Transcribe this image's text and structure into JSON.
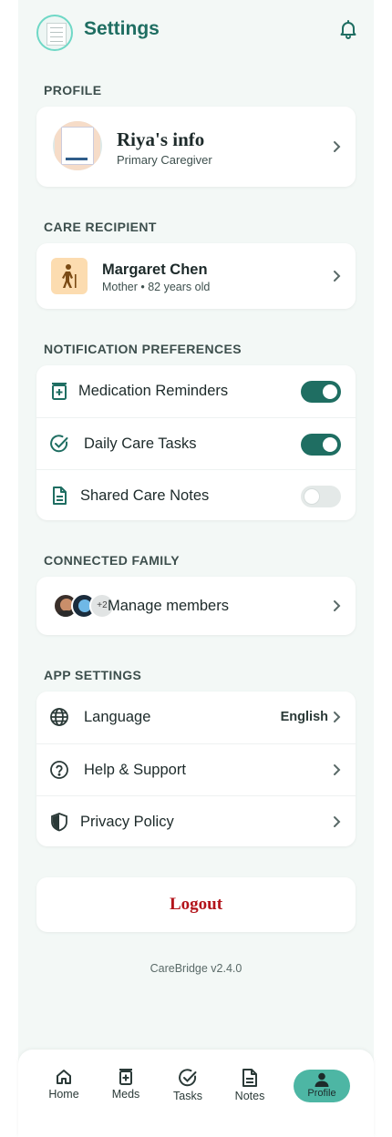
{
  "header": {
    "title": "Settings",
    "logo_icon": "document-icon",
    "bell_icon": "bell-icon"
  },
  "profile": {
    "section_label": "PROFILE",
    "name": "Riya's info",
    "role": "Primary Caregiver"
  },
  "care_recipient": {
    "section_label": "CARE RECIPIENT",
    "name": "Margaret Chen",
    "detail": "Mother • 82 years old",
    "avatar_icon": "elderly-person-icon",
    "avatar_bg": "#fcdcb0"
  },
  "notifications": {
    "section_label": "NOTIFICATION PREFERENCES",
    "items": [
      {
        "label": "Medication Reminders",
        "icon": "medication-icon",
        "enabled": true
      },
      {
        "label": "Daily Care Tasks",
        "icon": "check-circle-icon",
        "enabled": true
      },
      {
        "label": "Shared Care Notes",
        "icon": "notes-document-icon",
        "enabled": false
      }
    ]
  },
  "family": {
    "section_label": "CONNECTED FAMILY",
    "extra_count": "+2",
    "action": "Manage members"
  },
  "app_settings": {
    "section_label": "APP SETTINGS",
    "items": [
      {
        "label": "Language",
        "icon": "globe-icon",
        "value": "English"
      },
      {
        "label": "Help & Support",
        "icon": "help-circle-icon",
        "value": ""
      },
      {
        "label": "Privacy Policy",
        "icon": "shield-icon",
        "value": ""
      }
    ]
  },
  "logout": {
    "label": "Logout"
  },
  "footer": {
    "version": "CareBridge v2.4.0"
  },
  "nav": {
    "items": [
      {
        "label": "Home",
        "icon": "home-icon"
      },
      {
        "label": "Meds",
        "icon": "medication-icon"
      },
      {
        "label": "Tasks",
        "icon": "check-circle-icon"
      },
      {
        "label": "Notes",
        "icon": "notes-document-icon"
      },
      {
        "label": "Profile",
        "icon": "person-icon",
        "active": true
      }
    ]
  },
  "colors": {
    "brand": "#1f6e62",
    "accent": "#4db6a4",
    "background": "#f3f8f6",
    "logout": "#b3141b"
  }
}
